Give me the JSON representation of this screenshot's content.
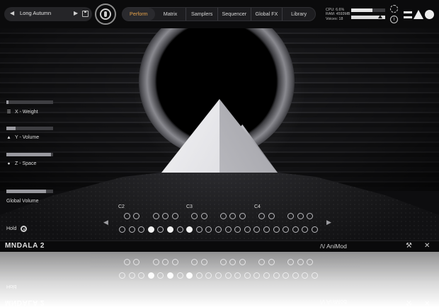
{
  "header": {
    "preset_name": "Long Autumn",
    "prev_glyph": "◀",
    "next_glyph": "▶",
    "tabs": [
      {
        "label": "Perform",
        "active": true
      },
      {
        "label": "Matrix",
        "active": false
      },
      {
        "label": "Samplers",
        "active": false
      },
      {
        "label": "Sequencer",
        "active": false
      },
      {
        "label": "Global FX",
        "active": false
      },
      {
        "label": "Library",
        "active": false
      }
    ],
    "stats": {
      "cpu": "CPU: 6.6%",
      "ram": "RAM: 4593MB",
      "voices": "Voices: 18"
    },
    "cpu_meter_level": 0.62,
    "info_glyph": "i",
    "icons": [
      "save-icon",
      "mindala-logo-icon",
      "gear-icon",
      "info-icon",
      "brand-logo-icon"
    ]
  },
  "controls": {
    "x": {
      "label": "X - Weight",
      "level": 0.05,
      "icon": "lines-icon",
      "glyph": "☰"
    },
    "y": {
      "label": "Y - Volume",
      "level": 0.2,
      "icon": "triangle-icon",
      "glyph": "▲"
    },
    "z": {
      "label": "Z - Space",
      "level": 0.95,
      "icon": "circle-icon",
      "glyph": "●"
    },
    "global_volume": {
      "label": "Global Volume",
      "level": 0.85
    },
    "hold_label": "Hold"
  },
  "keyboard": {
    "octave_labels": [
      "C2",
      "C3",
      "C4"
    ],
    "left_arrow": "◀",
    "right_arrow": "▶",
    "white_keys_active": [
      false,
      false,
      false,
      true,
      false,
      true,
      false,
      true,
      false,
      false,
      false,
      false,
      false,
      false,
      false,
      false,
      false,
      false,
      false,
      false,
      false
    ]
  },
  "footer": {
    "product_name": "MNDALA 2",
    "maker": "/\\/ AniMod",
    "tools": [
      "wrench-icon",
      "pin-icon"
    ],
    "wrench_glyph": "⚒",
    "pin_glyph": "✕"
  },
  "colors": {
    "accent": "#e7a34a",
    "background": "#0d0d0f",
    "text": "#d8d8d8"
  }
}
